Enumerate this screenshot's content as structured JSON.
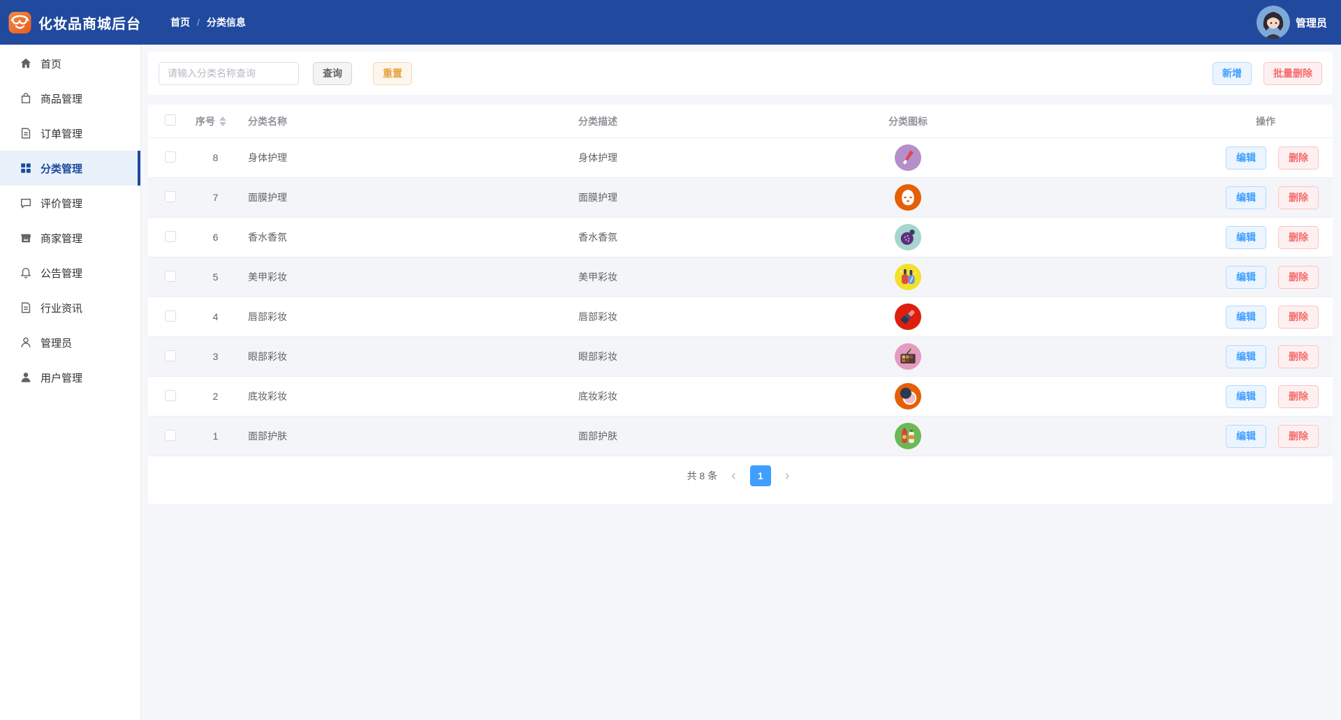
{
  "header": {
    "title": "化妆品商城后台",
    "breadcrumb": {
      "home": "首页",
      "separator": "/",
      "current": "分类信息"
    },
    "username": "管理员"
  },
  "sidebar": {
    "items": [
      {
        "key": "home",
        "label": "首页",
        "icon": "home-icon",
        "active": false
      },
      {
        "key": "products",
        "label": "商品管理",
        "icon": "bag-icon",
        "active": false
      },
      {
        "key": "orders",
        "label": "订单管理",
        "icon": "document-icon",
        "active": false
      },
      {
        "key": "categories",
        "label": "分类管理",
        "icon": "grid-icon",
        "active": true
      },
      {
        "key": "reviews",
        "label": "评价管理",
        "icon": "chat-bubble-icon",
        "active": false
      },
      {
        "key": "merchants",
        "label": "商家管理",
        "icon": "storefront-icon",
        "active": false
      },
      {
        "key": "notices",
        "label": "公告管理",
        "icon": "bell-icon",
        "active": false
      },
      {
        "key": "news",
        "label": "行业资讯",
        "icon": "document-icon",
        "active": false
      },
      {
        "key": "admins",
        "label": "管理员",
        "icon": "person-icon",
        "active": false
      },
      {
        "key": "users",
        "label": "用户管理",
        "icon": "person-filled-icon",
        "active": false
      }
    ]
  },
  "toolbar": {
    "search_placeholder": "请输入分类名称查询",
    "query_label": "查询",
    "reset_label": "重置",
    "add_label": "新增",
    "batch_delete_label": "批量删除"
  },
  "table": {
    "columns": {
      "seq": "序号",
      "name": "分类名称",
      "desc": "分类描述",
      "icon": "分类图标",
      "ops": "操作"
    },
    "edit_label": "编辑",
    "delete_label": "删除",
    "rows": [
      {
        "seq": "8",
        "name": "身体护理",
        "desc": "身体护理",
        "icon": "body-lotion-icon",
        "icon_bg": "#b58fc9"
      },
      {
        "seq": "7",
        "name": "面膜护理",
        "desc": "面膜护理",
        "icon": "face-mask-icon",
        "icon_bg": "#e65f07"
      },
      {
        "seq": "6",
        "name": "香水香氛",
        "desc": "香水香氛",
        "icon": "perfume-icon",
        "icon_bg": "#a6d6cd"
      },
      {
        "seq": "5",
        "name": "美甲彩妆",
        "desc": "美甲彩妆",
        "icon": "nail-polish-icon",
        "icon_bg": "#f3e02b"
      },
      {
        "seq": "4",
        "name": "唇部彩妆",
        "desc": "唇部彩妆",
        "icon": "lipstick-icon",
        "icon_bg": "#dd1f0c"
      },
      {
        "seq": "3",
        "name": "眼部彩妆",
        "desc": "眼部彩妆",
        "icon": "eyeshadow-icon",
        "icon_bg": "#e59ac2"
      },
      {
        "seq": "2",
        "name": "底妆彩妆",
        "desc": "底妆彩妆",
        "icon": "compact-powder-icon",
        "icon_bg": "#e65f07"
      },
      {
        "seq": "1",
        "name": "面部护肤",
        "desc": "面部护肤",
        "icon": "skincare-icon",
        "icon_bg": "#6cb854"
      }
    ]
  },
  "pagination": {
    "total_text": "共 8 条",
    "prev": "‹",
    "page": "1",
    "next": "›"
  },
  "colors": {
    "header_bg": "#21499e",
    "sidebar_active": "#1c4ba0",
    "primary": "#409eff",
    "danger": "#f56c6c",
    "warning": "#e6a23c",
    "page_bg": "#f6f7fb"
  }
}
